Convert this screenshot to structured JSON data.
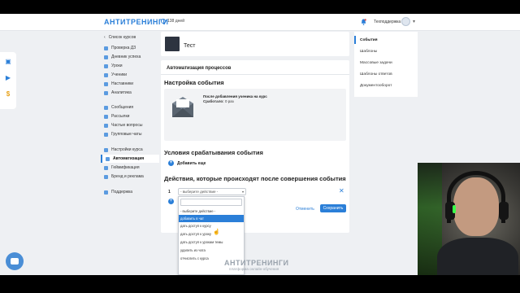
{
  "header": {
    "logo": "АНТИТРЕНИНГИ",
    "days": "138 дней",
    "support": "Техподдержка"
  },
  "sidebar": {
    "back": "Список курсов",
    "items": [
      {
        "label": "Проверка ДЗ"
      },
      {
        "label": "Дневник успеха"
      },
      {
        "label": "Уроки"
      },
      {
        "label": "Ученики"
      },
      {
        "label": "Наставники"
      },
      {
        "label": "Аналитика"
      },
      {
        "label": "Сообщения"
      },
      {
        "label": "Рассылки"
      },
      {
        "label": "Частые вопросы"
      },
      {
        "label": "Групповые чаты"
      },
      {
        "label": "Настройки курса"
      },
      {
        "label": "Автоматизация"
      },
      {
        "label": "Геймификация"
      },
      {
        "label": "Бренд и реклама"
      },
      {
        "label": "Поддержка"
      }
    ]
  },
  "course": {
    "title": "Тест"
  },
  "automation": {
    "title": "Автоматизация процессов",
    "event_heading": "Настройка события",
    "event_line1": "После добавления ученика на курс",
    "event_fired_label": "Сработало:",
    "event_fired_value": "0 раз",
    "conditions_heading": "Условия срабатывания события",
    "add_more": "Добавить еще",
    "actions_heading": "Действия, которые происходят после совершения события",
    "action_number": "1",
    "select_value": "- выберите действие -",
    "cancel": "Отменить",
    "save": "Сохранить"
  },
  "dropdown": {
    "options": [
      "- выберите действие -",
      "добавить в чат",
      "дать доступ к курсу",
      "дать доступ к уроку",
      "дать доступ к урокам темы",
      "удалить из чата",
      "отчислить с курса"
    ],
    "selected_index": 1
  },
  "right_panel": {
    "items": [
      "События",
      "Шаблоны",
      "Массовые задачи",
      "Шаблоны ответов",
      "Документооборот"
    ]
  },
  "footer": {
    "logo": "АНТИТРЕНИНГИ",
    "subtitle": "платформа онлайн-обучения"
  },
  "colors": {
    "accent": "#2b7fd8",
    "background": "#eef0f3"
  }
}
